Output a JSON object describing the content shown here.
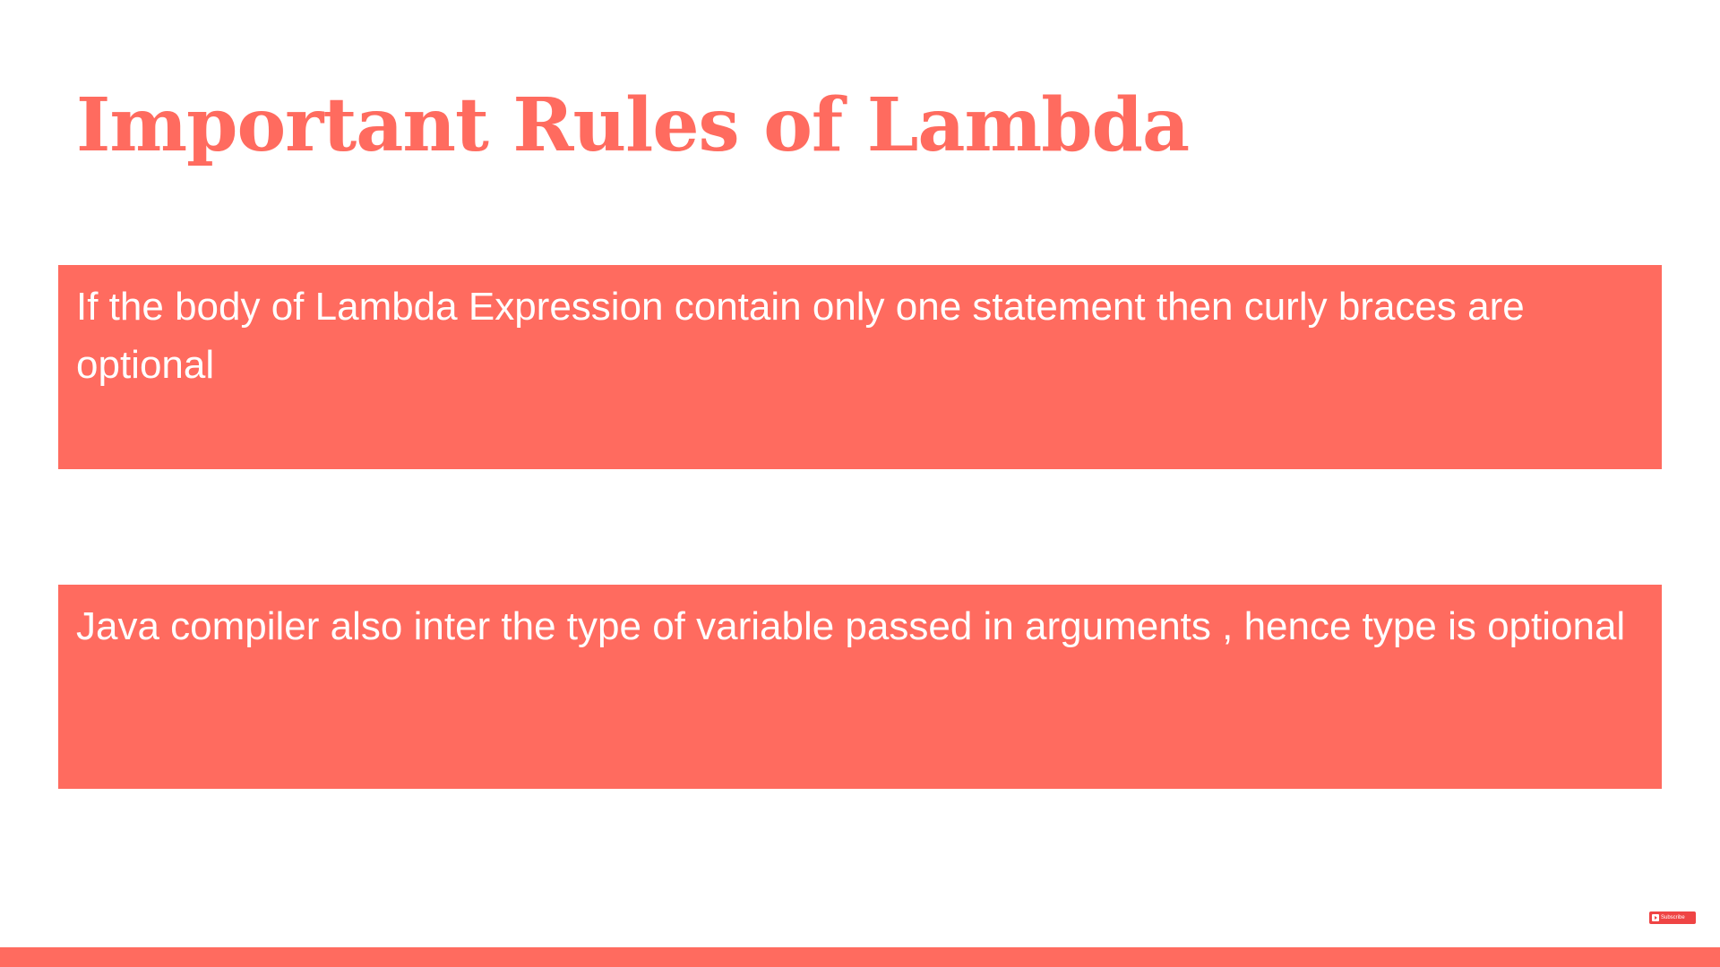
{
  "slide": {
    "title": "Important Rules of Lambda",
    "rules": [
      {
        "text": "If the body of Lambda Expression contain only one statement then curly braces are optional"
      },
      {
        "text": "Java compiler also inter the type of variable passed in arguments , hence type is optional"
      }
    ]
  },
  "subscribe": {
    "label": "Subscribe",
    "icon": "youtube-play-icon"
  },
  "colors": {
    "accent": "#ff6b5f",
    "background": "#ffffff",
    "text_on_accent": "#ffffff"
  }
}
